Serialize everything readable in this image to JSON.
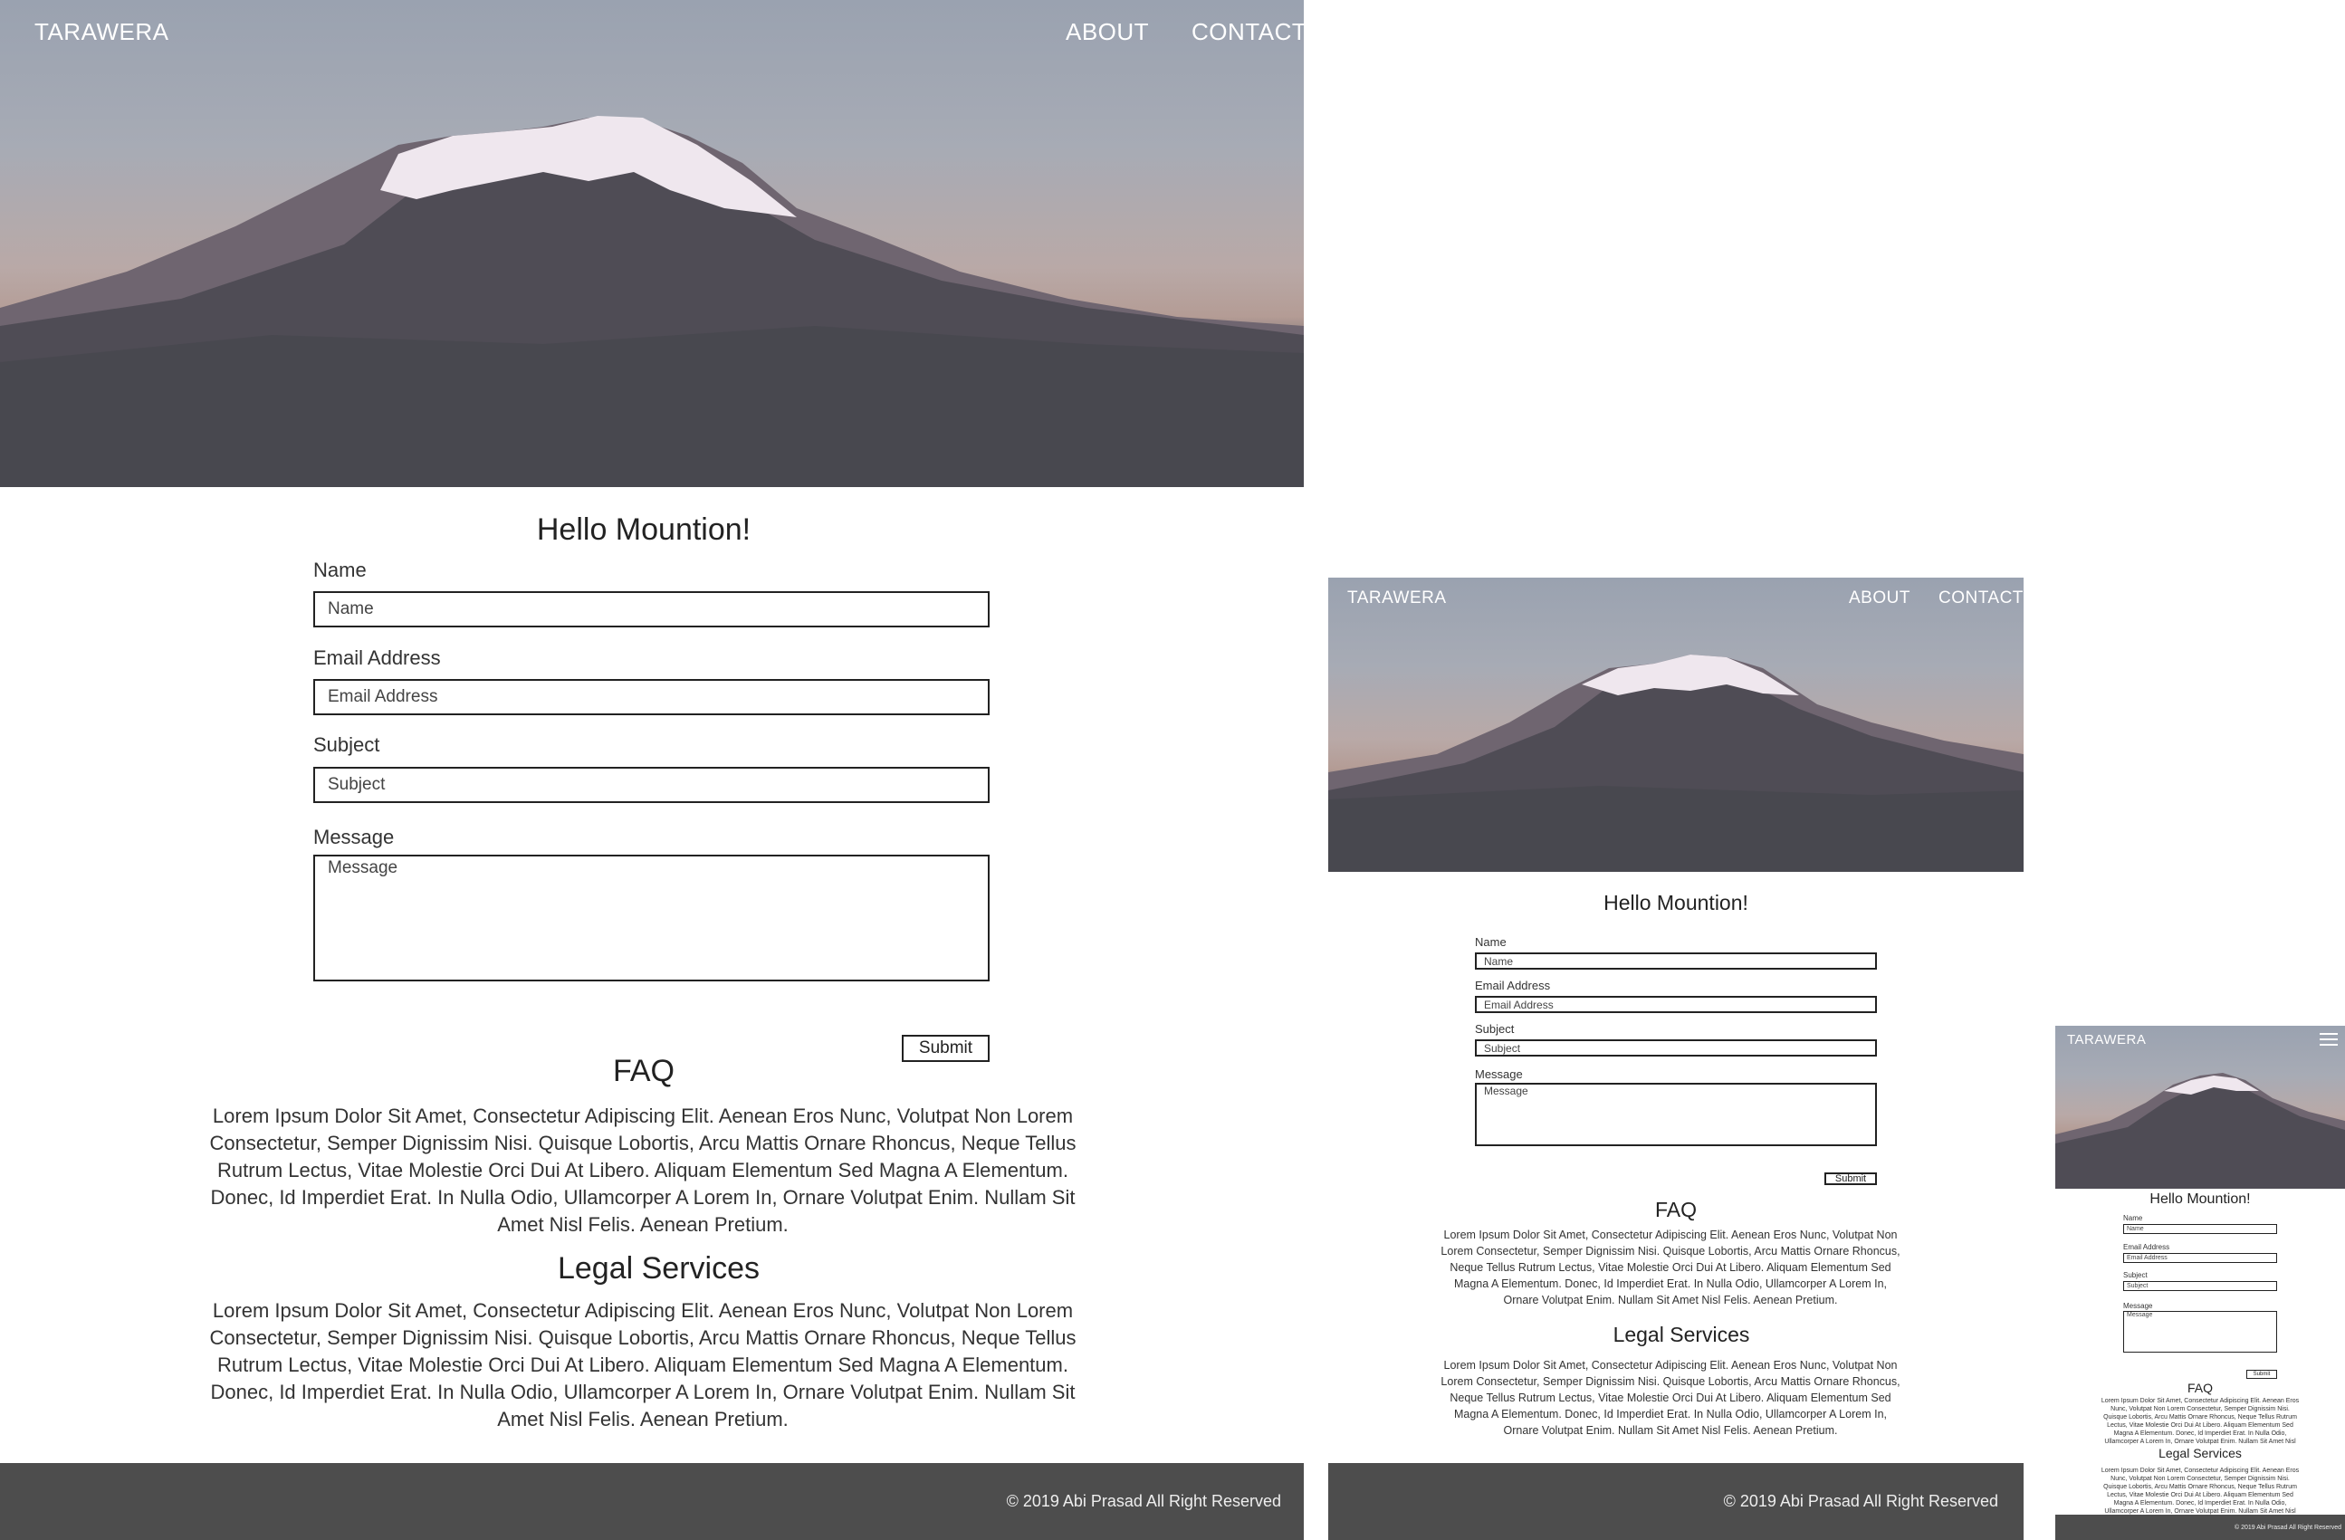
{
  "brand": "TARAWERA",
  "nav": {
    "about": "ABOUT",
    "contact": "CONTACT"
  },
  "hero_image": "mountain-photo",
  "form": {
    "title": "Hello Mountion!",
    "name_label": "Name",
    "name_placeholder": "Name",
    "email_label": "Email Address",
    "email_placeholder": "Email Address",
    "subject_label": "Subject",
    "subject_placeholder": "Subject",
    "message_label": "Message",
    "message_placeholder": "Message",
    "submit": "Submit"
  },
  "faq": {
    "title": "FAQ",
    "text": "Lorem Ipsum Dolor Sit Amet, Consectetur Adipiscing Elit. Aenean Eros Nunc, Volutpat Non Lorem Consectetur, Semper Dignissim Nisi. Quisque Lobortis, Arcu Mattis Ornare Rhoncus, Neque Tellus Rutrum Lectus, Vitae Molestie Orci Dui At Libero. Aliquam Elementum Sed Magna A Elementum. Donec, Id Imperdiet Erat. In Nulla Odio, Ullamcorper A Lorem In, Ornare Volutpat Enim. Nullam Sit Amet Nisl Felis. Aenean Pretium."
  },
  "legal": {
    "title": "Legal Services",
    "text": "Lorem Ipsum Dolor Sit Amet, Consectetur Adipiscing Elit. Aenean Eros Nunc, Volutpat Non Lorem Consectetur, Semper Dignissim Nisi. Quisque Lobortis, Arcu Mattis Ornare Rhoncus, Neque Tellus Rutrum Lectus, Vitae Molestie Orci Dui At Libero. Aliquam Elementum Sed Magna A Elementum. Donec, Id Imperdiet Erat. In Nulla Odio, Ullamcorper A Lorem In, Ornare Volutpat Enim. Nullam Sit Amet Nisl Felis. Aenean Pretium."
  },
  "footer": "© 2019 Abi Prasad All Right Reserved",
  "colors": {
    "footer_bg": "#4d4d4d",
    "text": "#333333",
    "accent": "#ffffff"
  },
  "icons": {
    "menu": "hamburger-menu-icon"
  }
}
